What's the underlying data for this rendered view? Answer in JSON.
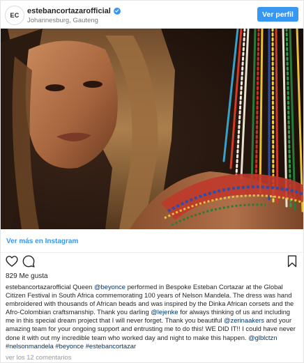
{
  "header": {
    "avatar_initials": "EC",
    "username": "estebancortazarofficial",
    "location": "Johannesburg, Gauteng",
    "view_profile_label": "Ver perfil",
    "verified_icon": "verified-badge-icon"
  },
  "colors": {
    "accent": "#3897f0",
    "link": "#003569",
    "muted": "#999999"
  },
  "media": {
    "description_icon": "photo"
  },
  "more_on_instagram": "Ver más en Instagram",
  "actions": {
    "like_icon": "heart-icon",
    "comment_icon": "comment-icon",
    "save_icon": "bookmark-icon"
  },
  "likes": "829 Me gusta",
  "caption": {
    "user": "estebancortazarofficial",
    "p1": " Queen ",
    "m1": "@beyonce",
    "p2": " performed in Bespoke Esteban Cortazar at the Global Citizen Festival in South Africa commemorating 100 years of Nelson Mandela. The dress was hand embroidered with thousands of African beads and was inspired by the Dinka African corsets and the Afro-Colombian craftsmanship. Thank you darling ",
    "m2": "@lejenke",
    "p3": " for always thinking of us and including me in this special dream project that I will never forget. Thank you beautiful ",
    "m3": "@zerinaakers",
    "p4": " and your amazing team for your ongoing support and entrusting me to do this! WE DID IT!! I could have never done it with out my incredible team who worked day and night to make this happen. ",
    "m4": "@glblctzn",
    "t1": "#nelsonmandela",
    "t2": "#beyonce",
    "t3": "#estebancortazar"
  },
  "comments_link": "ver los 12 comentarios"
}
